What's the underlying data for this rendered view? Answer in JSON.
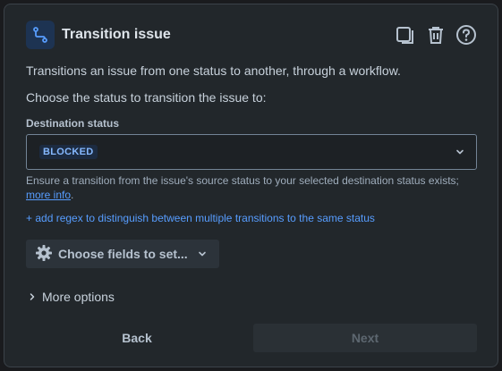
{
  "header": {
    "title": "Transition issue",
    "icons": [
      "transition-icon",
      "duplicate-icon",
      "trash-icon",
      "help-icon"
    ]
  },
  "body": {
    "description": "Transitions an issue from one status to another, through a workflow.",
    "prompt": "Choose the status to transition the issue to:",
    "field_label": "Destination status",
    "selected_status": "BLOCKED",
    "help_text": "Ensure a transition from the issue's source status to your selected destination status exists;",
    "help_link": "more info",
    "help_tail": ".",
    "regex_link": "+ add regex to distinguish between multiple transitions to the same status",
    "fields_button": "Choose fields to set...",
    "more_options": "More options"
  },
  "footer": {
    "back_label": "Back",
    "next_label": "Next"
  },
  "colors": {
    "panel_bg": "#22272b",
    "link": "#579dff",
    "lozenge_bg": "#1c2b41",
    "lozenge_text": "#85b8ff",
    "app_icon_bg": "#1d3352"
  }
}
